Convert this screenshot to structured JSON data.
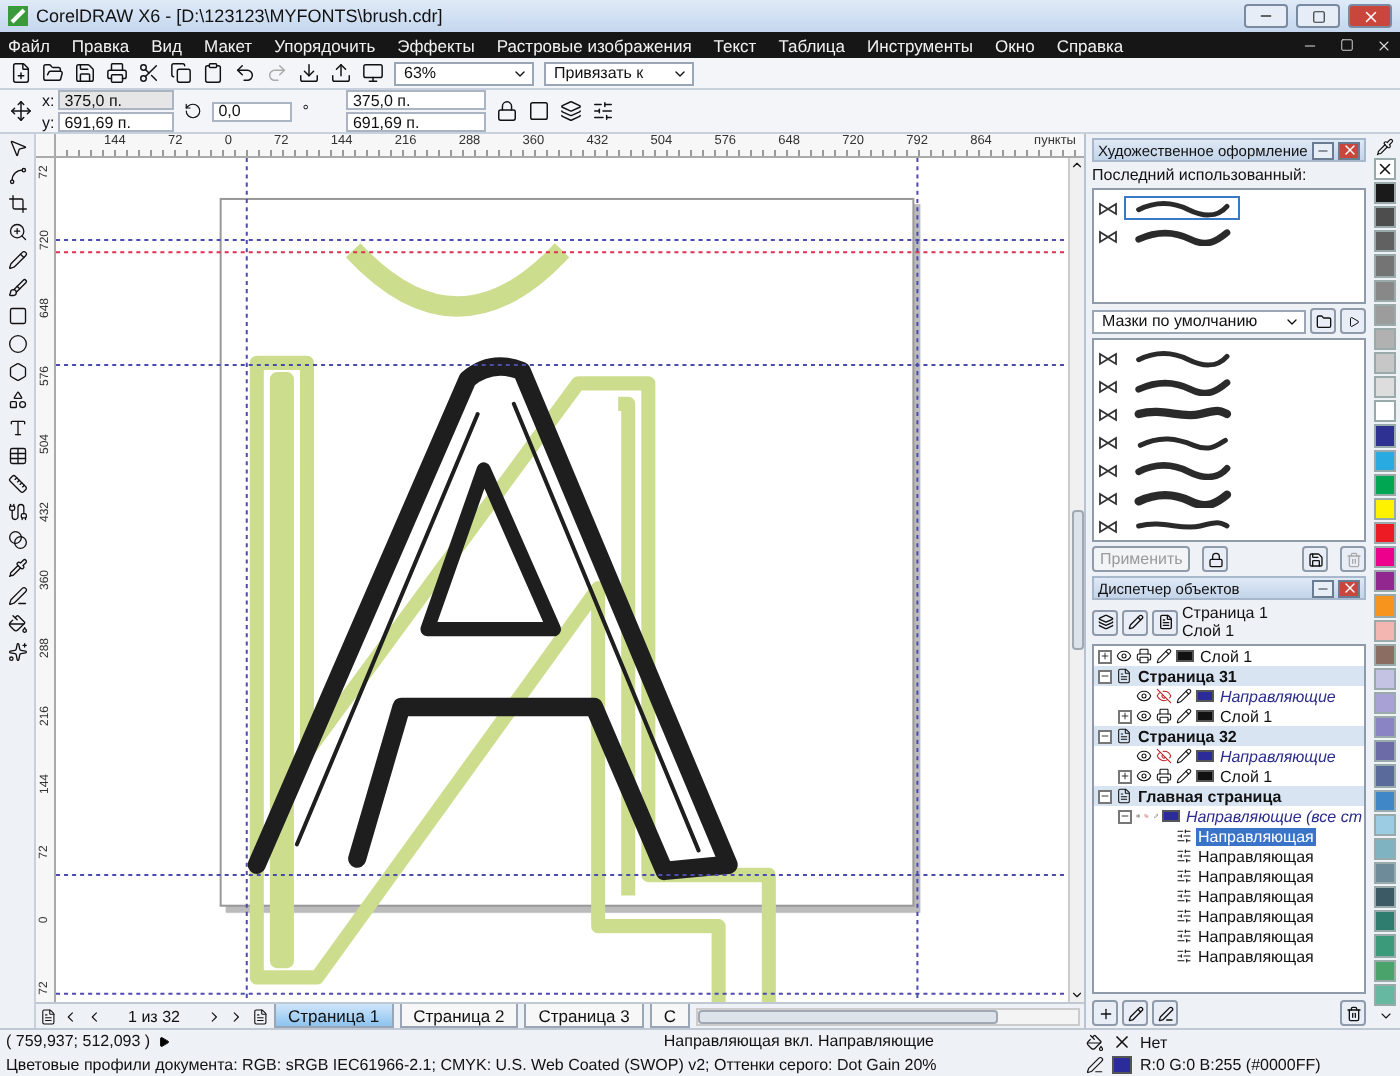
{
  "window": {
    "title": "CorelDRAW X6 - [D:\\123123\\MYFONTS\\brush.cdr]"
  },
  "menu": [
    "Файл",
    "Правка",
    "Вид",
    "Макет",
    "Упорядочить",
    "Эффекты",
    "Растровые изображения",
    "Текст",
    "Таблица",
    "Инструменты",
    "Окно",
    "Справка"
  ],
  "toolbar": {
    "zoom": "63%",
    "snap": "Привязать к"
  },
  "property_bar": {
    "x_label": "x:",
    "x": "375,0 п.",
    "y_label": "y:",
    "y": "691,69 п.",
    "angle": "0,0",
    "angle_unit": "°",
    "width": "375,0 п.",
    "height": "691,69 п."
  },
  "ruler": {
    "unit": "пункты",
    "x_ticks": [
      "144",
      "72",
      "0",
      "72",
      "144",
      "216",
      "288",
      "360",
      "432",
      "504",
      "576",
      "648",
      "720",
      "792",
      "864"
    ],
    "y_ticks": [
      "72",
      "720",
      "648",
      "576",
      "504",
      "432",
      "360",
      "288",
      "216",
      "144",
      "72",
      "0",
      "72"
    ]
  },
  "page_nav": {
    "position": "1 из 32",
    "tabs": [
      {
        "label": "Страница 1",
        "selected": true
      },
      {
        "label": "Страница 2",
        "selected": false
      },
      {
        "label": "Страница 3",
        "selected": false
      },
      {
        "label": "С",
        "selected": false
      }
    ]
  },
  "artistic_media": {
    "title": "Художественное оформление",
    "recent_label": "Последний использованный:",
    "recent": [
      {
        "selected": true
      },
      {
        "selected": false
      }
    ],
    "library": "Мазки по умолчанию",
    "brushes": [
      {
        "selected": false
      },
      {
        "selected": false
      },
      {
        "selected": false
      },
      {
        "selected": false
      },
      {
        "selected": false
      },
      {
        "selected": false
      },
      {
        "selected": false
      }
    ],
    "apply": {
      "label": "Применить",
      "disabled": true
    }
  },
  "object_manager": {
    "title": "Диспетчер объектов",
    "current_page": "Страница 1",
    "current_layer": "Слой 1",
    "tree": [
      {
        "kind": "layer",
        "label": "Слой 1",
        "expanded": false
      },
      {
        "kind": "page",
        "label": "Страница 31",
        "expanded": true,
        "children": [
          {
            "kind": "guides",
            "label": "Направляющие"
          },
          {
            "kind": "layer",
            "label": "Слой 1",
            "expanded": false
          }
        ]
      },
      {
        "kind": "page",
        "label": "Страница 32",
        "expanded": true,
        "children": [
          {
            "kind": "guides",
            "label": "Направляющие"
          },
          {
            "kind": "layer",
            "label": "Слой 1",
            "expanded": false
          }
        ]
      },
      {
        "kind": "page",
        "label": "Главная страница",
        "expanded": true,
        "children": [
          {
            "kind": "guides",
            "label": "Направляющие (все ст",
            "expanded": true,
            "children": [
              {
                "kind": "guide",
                "label": "Направляющая",
                "selected": true
              },
              {
                "kind": "guide",
                "label": "Направляющая",
                "selected": false
              },
              {
                "kind": "guide",
                "label": "Направляющая",
                "selected": false
              },
              {
                "kind": "guide",
                "label": "Направляющая",
                "selected": false
              },
              {
                "kind": "guide",
                "label": "Направляющая",
                "selected": false
              },
              {
                "kind": "guide",
                "label": "Направляющая",
                "selected": false
              },
              {
                "kind": "guide",
                "label": "Направляющая",
                "selected": false
              }
            ]
          }
        ]
      }
    ]
  },
  "status": {
    "coords": "( 759,937; 512,093 )",
    "message": "Направляющая вкл. Направляющие",
    "fill": "Нет",
    "outline": "R:0 G:0 B:255 (#0000FF)",
    "profiles": "Цветовые профили документа: RGB: sRGB IEC61966-2.1; CMYK: U.S. Web Coated (SWOP) v2; Оттенки серого: Dot Gain 20%"
  },
  "palette": [
    {
      "color": "#1a1a1a"
    },
    {
      "color": "#4d4d4d"
    },
    {
      "color": "#616161"
    },
    {
      "color": "#747474"
    },
    {
      "color": "#888888"
    },
    {
      "color": "#9c9c9c"
    },
    {
      "color": "#b1b1b1"
    },
    {
      "color": "#c7c7c7"
    },
    {
      "color": "#dddddd"
    },
    {
      "color": "#ffffff"
    },
    {
      "color": "#2e3192"
    },
    {
      "color": "#29abe2"
    },
    {
      "color": "#00a651"
    },
    {
      "color": "#fff200"
    },
    {
      "color": "#ed1c24"
    },
    {
      "color": "#ec008c"
    },
    {
      "color": "#92278f"
    },
    {
      "color": "#f7941d"
    },
    {
      "color": "#f4b6b0"
    },
    {
      "color": "#8c6d62"
    },
    {
      "color": "#c5c3e3"
    },
    {
      "color": "#a7a1d6"
    },
    {
      "color": "#8b84c4"
    },
    {
      "color": "#6d6aa8"
    },
    {
      "color": "#5a6a9a"
    },
    {
      "color": "#3f87c7"
    },
    {
      "color": "#9ccbe4"
    },
    {
      "color": "#7fb3c2"
    },
    {
      "color": "#6d8b99"
    },
    {
      "color": "#3c5a66"
    },
    {
      "color": "#2e7d6e"
    },
    {
      "color": "#3b9a7a"
    },
    {
      "color": "#4aa36b"
    },
    {
      "color": "#66b8a0"
    }
  ]
}
